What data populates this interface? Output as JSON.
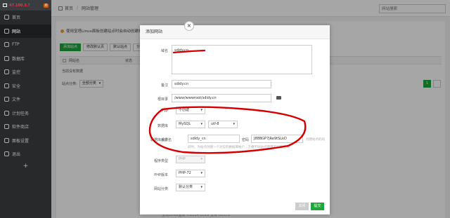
{
  "sidebar": {
    "logo_text": "",
    "logo_red": "47.100.3.?",
    "badge": "0",
    "items": [
      {
        "label": "首页",
        "icon": "home-icon"
      },
      {
        "label": "网站",
        "icon": "globe-icon"
      },
      {
        "label": "FTP",
        "icon": "ftp-icon"
      },
      {
        "label": "数据库",
        "icon": "database-icon"
      },
      {
        "label": "监控",
        "icon": "monitor-icon"
      },
      {
        "label": "安全",
        "icon": "shield-icon"
      },
      {
        "label": "文件",
        "icon": "folder-icon"
      },
      {
        "label": "计划任务",
        "icon": "clock-icon"
      },
      {
        "label": "软件商店",
        "icon": "store-icon"
      },
      {
        "label": "面板设置",
        "icon": "gear-icon"
      },
      {
        "label": "退出",
        "icon": "logout-icon"
      }
    ],
    "add": "+"
  },
  "topbar": {
    "home": "首页",
    "sep": "/",
    "current": "网站管理",
    "search_placeholder": "网站搜索"
  },
  "main": {
    "warning": "使用宝塔Linux面板创建站点时会自动创建权限配置",
    "buttons": [
      "添加站点",
      "修改默认页",
      "默认站点",
      "分类"
    ],
    "headers": [
      "网站名",
      "状态"
    ],
    "no_data": "当前没有数据",
    "category_label": "站点分类:",
    "category_value": "全部分类",
    "page": "1"
  },
  "footer": "宝塔Linux面板 ©2014-2019 宝塔 (bt.cn)",
  "modal": {
    "title": "添加网站",
    "close": "×",
    "domain_label": "域名",
    "domain_value": "sdidy.cn",
    "remark_label": "备注",
    "remark_value": "sdidy.cn",
    "root_label": "根目录",
    "root_value": "/www/wwwroot/sdidy.cn",
    "ftp_label": "FTP",
    "ftp_value": "不创建",
    "db_label": "数据库",
    "db_type": "MySQL",
    "db_charset": "utf-8",
    "db_settings_label": "数据库设置",
    "db_user_label": "用户名",
    "db_user_value": "sdidy_cn",
    "db_pass_label": "密码",
    "db_pass_value": "J88BGP7jRe9tSLkD",
    "db_hint_right": "创建站点的同",
    "db_hint_below": "同时，为站点创建一个对应的数据库帐户，方便不同站点使用不同数据库。",
    "program_label": "程序类型",
    "program_value": "PHP",
    "php_label": "PHP版本",
    "php_value": "PHP-72",
    "category_label": "网站分类",
    "category_value": "默认分类",
    "cancel": "关闭",
    "submit": "提交"
  },
  "colors": {
    "accent": "#20a53a",
    "annotation": "#d40000",
    "sidebar": "#27292b"
  }
}
